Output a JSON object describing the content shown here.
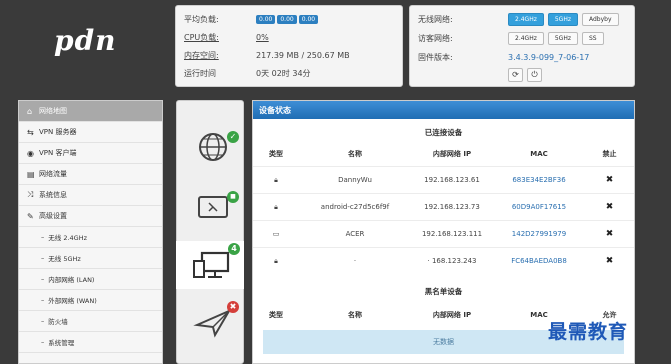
{
  "brand": {
    "logo": "pdn"
  },
  "status": {
    "load_label": "平均负载:",
    "load_values": [
      "0.00",
      "0.00",
      "0.00"
    ],
    "cpu_label": "CPU负载:",
    "cpu_value": "0%",
    "mem_label": "内存空间:",
    "mem_value": "217.39 MB / 250.67 MB",
    "uptime_label": "运行时间",
    "uptime_value": "0天 02时 34分"
  },
  "network": {
    "wireless_label": "无线网络:",
    "wireless_buttons": [
      "2.4GHz",
      "5GHz",
      "Adbyby"
    ],
    "ap_label": "访客网络:",
    "ap_buttons": [
      "2.4GHz",
      "5GHz",
      "SS"
    ],
    "firmware_label": "固件版本:",
    "firmware_value": "3.4.3.9-099_7-06-17",
    "refresh_icon": "refresh-icon",
    "power_icon": "power-icon"
  },
  "sidebar": {
    "items": [
      {
        "label": "网络地图",
        "icon": "home-icon",
        "active": true
      },
      {
        "label": "VPN 服务器",
        "icon": "vpn-server-icon"
      },
      {
        "label": "VPN 客户端",
        "icon": "globe-icon"
      },
      {
        "label": "网络流量",
        "icon": "chart-icon"
      },
      {
        "label": "系统信息",
        "icon": "shuffle-icon"
      },
      {
        "label": "高级设置",
        "icon": "wrench-icon"
      }
    ],
    "subitems": [
      "无线 2.4GHz",
      "无线 5GHz",
      "内部网络 (LAN)",
      "外部网络 (WAN)",
      "防火墙",
      "系统管理"
    ]
  },
  "device_tabs": [
    {
      "name": "router",
      "icon": "router-globe-icon",
      "badge": "✓",
      "badge_color": "#3aa346"
    },
    {
      "name": "internet",
      "icon": "tablet-icon",
      "badge": "🔒",
      "badge_color": "#3aa346"
    },
    {
      "name": "clients",
      "icon": "monitor-icon",
      "badge": "4",
      "badge_color": "#3aa346"
    },
    {
      "name": "blocked",
      "icon": "plane-icon",
      "badge": "✖",
      "badge_color": "#d43f3a"
    }
  ],
  "main": {
    "title": "设备状态",
    "connected_heading": "已连接设备",
    "columns": [
      "类型",
      "名称",
      "内部网络 IP",
      "MAC",
      "禁止"
    ],
    "devices": [
      {
        "type_icon": "lock-icon",
        "name": "DannyWu",
        "ip": "192.168.123.61",
        "mac": "683E34E2BF36"
      },
      {
        "type_icon": "lock-icon",
        "name": "android-c27d5c6f9f",
        "ip": "192.168.123.73",
        "mac": "60D9A0F17615"
      },
      {
        "type_icon": "monitor-icon",
        "name": "ACER",
        "ip": "192.168.123.111",
        "mac": "142D27991979"
      },
      {
        "type_icon": "lock-icon",
        "name": "·",
        "ip": "· 168.123.243",
        "mac": "FC64BAEDA0B8"
      }
    ],
    "block_glyph": "✖",
    "blacklist_heading": "黑名单设备",
    "blacklist_columns": [
      "类型",
      "名称",
      "内部网络 IP",
      "MAC",
      "允许"
    ],
    "nodata": "无数据"
  },
  "watermark": "最需教育"
}
